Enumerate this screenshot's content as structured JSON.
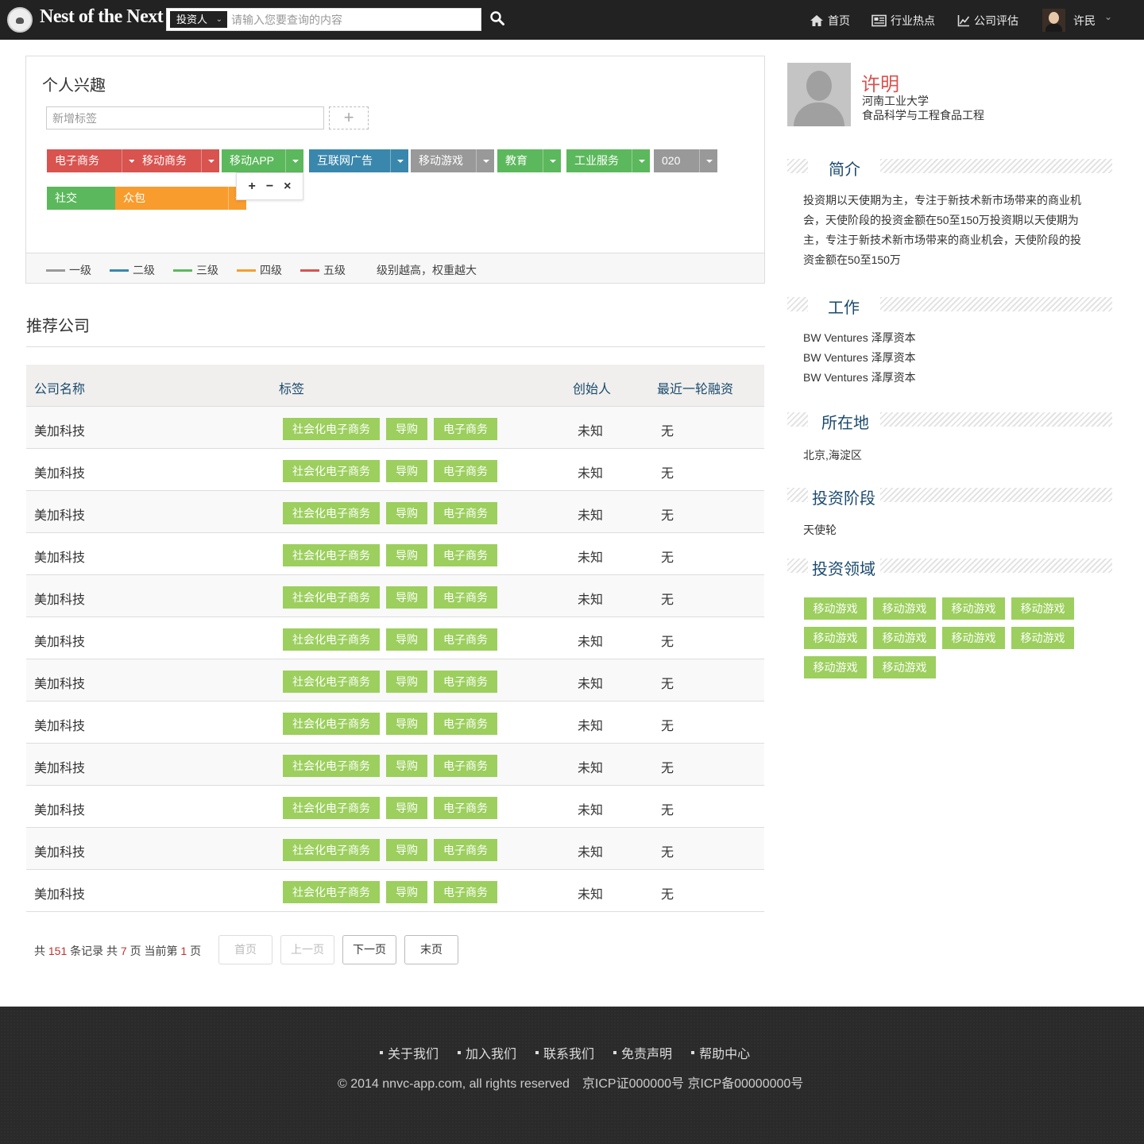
{
  "navbar": {
    "brand": "Nest of the Next",
    "search_type": "投资人",
    "search_placeholder": "请输入您要查询的内容",
    "nav_items": [
      {
        "label": "首页",
        "icon": "home-icon"
      },
      {
        "label": "行业热点",
        "icon": "news-icon"
      },
      {
        "label": "公司评估",
        "icon": "chart-icon"
      }
    ],
    "user_name": "许民"
  },
  "interest": {
    "title": "个人兴趣",
    "input_placeholder": "新增标签",
    "add_icon": "+",
    "tags": [
      {
        "label": "电子商务",
        "color": "#d9534f"
      },
      {
        "label": "移动商务",
        "color": "#d9534f"
      },
      {
        "label": "移动APP",
        "color": "#5cb85c"
      },
      {
        "label": "互联网广告",
        "color": "#3a87ad"
      },
      {
        "label": "移动游戏",
        "color": "#999999"
      },
      {
        "label": "教育",
        "color": "#5cb85c"
      },
      {
        "label": "工业服务",
        "color": "#5cb85c"
      },
      {
        "label": "020",
        "color": "#999999"
      },
      {
        "label": "社交",
        "color": "#5cb85c"
      },
      {
        "label": "众包",
        "color": "#f89c2e"
      }
    ],
    "level_popup": {
      "plus": "+",
      "minus": "−",
      "close": "×"
    },
    "legend": [
      {
        "label": "一级",
        "color": "#999999"
      },
      {
        "label": "二级",
        "color": "#3a87ad"
      },
      {
        "label": "三级",
        "color": "#5cb85c"
      },
      {
        "label": "四级",
        "color": "#f89c2e"
      },
      {
        "label": "五级",
        "color": "#d9534f"
      }
    ],
    "legend_note": "级别越高，权重越大"
  },
  "recommend": {
    "title": "推荐公司",
    "columns": [
      "公司名称",
      "标签",
      "创始人",
      "最近一轮融资"
    ],
    "rows": [
      {
        "name": "美加科技",
        "tags": [
          "社会化电子商务",
          "导购",
          "电子商务"
        ],
        "founder": "未知",
        "round": "无"
      },
      {
        "name": "美加科技",
        "tags": [
          "社会化电子商务",
          "导购",
          "电子商务"
        ],
        "founder": "未知",
        "round": "无"
      },
      {
        "name": "美加科技",
        "tags": [
          "社会化电子商务",
          "导购",
          "电子商务"
        ],
        "founder": "未知",
        "round": "无"
      },
      {
        "name": "美加科技",
        "tags": [
          "社会化电子商务",
          "导购",
          "电子商务"
        ],
        "founder": "未知",
        "round": "无"
      },
      {
        "name": "美加科技",
        "tags": [
          "社会化电子商务",
          "导购",
          "电子商务"
        ],
        "founder": "未知",
        "round": "无"
      },
      {
        "name": "美加科技",
        "tags": [
          "社会化电子商务",
          "导购",
          "电子商务"
        ],
        "founder": "未知",
        "round": "无"
      },
      {
        "name": "美加科技",
        "tags": [
          "社会化电子商务",
          "导购",
          "电子商务"
        ],
        "founder": "未知",
        "round": "无"
      },
      {
        "name": "美加科技",
        "tags": [
          "社会化电子商务",
          "导购",
          "电子商务"
        ],
        "founder": "未知",
        "round": "无"
      },
      {
        "name": "美加科技",
        "tags": [
          "社会化电子商务",
          "导购",
          "电子商务"
        ],
        "founder": "未知",
        "round": "无"
      },
      {
        "name": "美加科技",
        "tags": [
          "社会化电子商务",
          "导购",
          "电子商务"
        ],
        "founder": "未知",
        "round": "无"
      },
      {
        "name": "美加科技",
        "tags": [
          "社会化电子商务",
          "导购",
          "电子商务"
        ],
        "founder": "未知",
        "round": "无"
      },
      {
        "name": "美加科技",
        "tags": [
          "社会化电子商务",
          "导购",
          "电子商务"
        ],
        "founder": "未知",
        "round": "无"
      }
    ]
  },
  "pagination": {
    "prefix": "共",
    "total_records": "151",
    "records_mid": "条记录 共",
    "total_pages": "7",
    "pages_mid": "页 当前第",
    "current_page": "1",
    "suffix": "页",
    "buttons": [
      {
        "label": "首页",
        "state": "disabled"
      },
      {
        "label": "上一页",
        "state": "disabled"
      },
      {
        "label": "下一页",
        "state": "active"
      },
      {
        "label": "末页",
        "state": "active"
      }
    ]
  },
  "profile": {
    "name": "许明",
    "school": "河南工业大学",
    "major": "食品科学与工程食品工程",
    "sections": {
      "intro_title": "简介",
      "intro_text": "投资期以天使期为主，专注于新技术新市场带来的商业机会，天使阶段的投资金额在50至150万投资期以天使期为主，专注于新技术新市场带来的商业机会，天使阶段的投资金额在50至150万",
      "work_title": "工作",
      "work_items": [
        "BW Ventures 泽厚资本",
        "BW Ventures 泽厚资本",
        "BW Ventures 泽厚资本"
      ],
      "location_title": "所在地",
      "location": "北京,海淀区",
      "stage_title": "投资阶段",
      "stage": "天使轮",
      "field_title": "投资领域",
      "fields": [
        "移动游戏",
        "移动游戏",
        "移动游戏",
        "移动游戏",
        "移动游戏",
        "移动游戏",
        "移动游戏",
        "移动游戏",
        "移动游戏",
        "移动游戏"
      ]
    }
  },
  "footer": {
    "links": [
      "关于我们",
      "加入我们",
      "联系我们",
      "免责声明",
      "帮助中心"
    ],
    "copyright": "© 2014 nnvc-app.com, all rights reserved　京ICP证000000号 京ICP备00000000号"
  },
  "colors": {
    "tag_green": "#9ccf5e",
    "name_red": "#d9534f",
    "heading_blue": "#1a4a6e",
    "navbar": "#222222",
    "footer": "#2a2a2a"
  }
}
